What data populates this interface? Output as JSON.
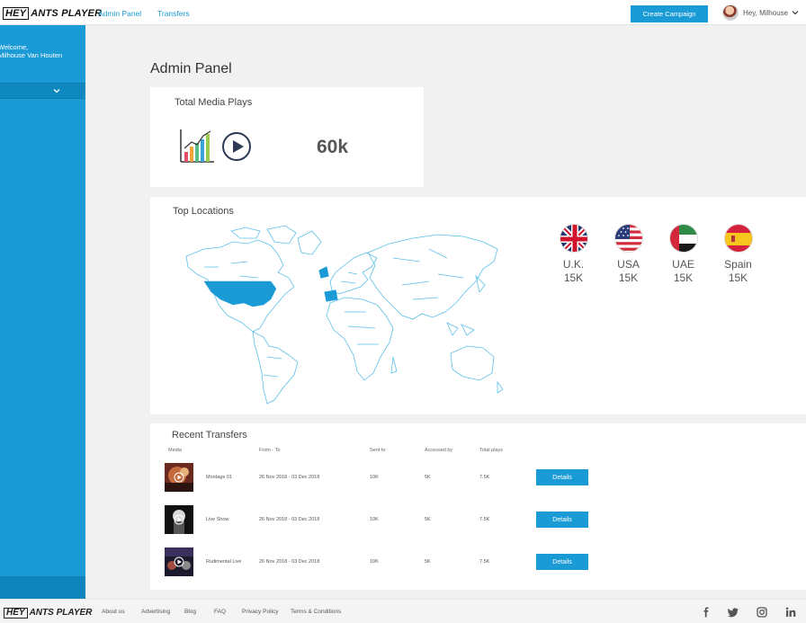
{
  "brand": {
    "logo_hey": "HEY",
    "logo_rest": "ANTS PLAYER"
  },
  "nav": {
    "links": [
      "Admin Panel",
      "Transfers"
    ]
  },
  "header": {
    "create_button": "Create Campaign",
    "user_greeting": "Hey, Milhouse"
  },
  "sidebar": {
    "welcome_line1": "Welcome,",
    "welcome_line2": "Milhouse Van Houten"
  },
  "page": {
    "title": "Admin Panel"
  },
  "media_plays": {
    "title": "Total Media Plays",
    "value": "60k"
  },
  "locations": {
    "title": "Top Locations",
    "items": [
      {
        "name": "U.K.",
        "value": "15K",
        "flag": "uk-flag"
      },
      {
        "name": "USA",
        "value": "15K",
        "flag": "usa-flag"
      },
      {
        "name": "UAE",
        "value": "15K",
        "flag": "uae-flag"
      },
      {
        "name": "Spain",
        "value": "15K",
        "flag": "spain-flag"
      }
    ],
    "highlight_color": "#1a9bd6"
  },
  "transfers": {
    "title": "Recent Transfers",
    "columns": [
      "Media",
      "From - To",
      "Sent to",
      "Accessed by",
      "Total plays"
    ],
    "rows": [
      {
        "name": "Montage 01",
        "dates": "26 Nov 2018 - 03 Dec 2018",
        "sent_to": "10K",
        "accessed_by": "5K",
        "total_plays": "7.5K",
        "action": "Details"
      },
      {
        "name": "Live Show",
        "dates": "26 Nov 2018 - 03 Dec 2018",
        "sent_to": "10K",
        "accessed_by": "5K",
        "total_plays": "7.5K",
        "action": "Details"
      },
      {
        "name": "Rudimental Live",
        "dates": "26 Nov 2018 - 03 Dec 2018",
        "sent_to": "10K",
        "accessed_by": "5K",
        "total_plays": "7.5K",
        "action": "Details"
      }
    ]
  },
  "footer": {
    "links": [
      "About us",
      "Advertising",
      "Blog",
      "FAQ",
      "Privacy Policy",
      "Terms & Conditions"
    ],
    "social": [
      "facebook-icon",
      "twitter-icon",
      "instagram-icon",
      "linkedin-icon"
    ]
  },
  "colors": {
    "accent": "#1a9bd6",
    "sidebar": "#1a9bd6",
    "background": "#f1f1f2"
  }
}
